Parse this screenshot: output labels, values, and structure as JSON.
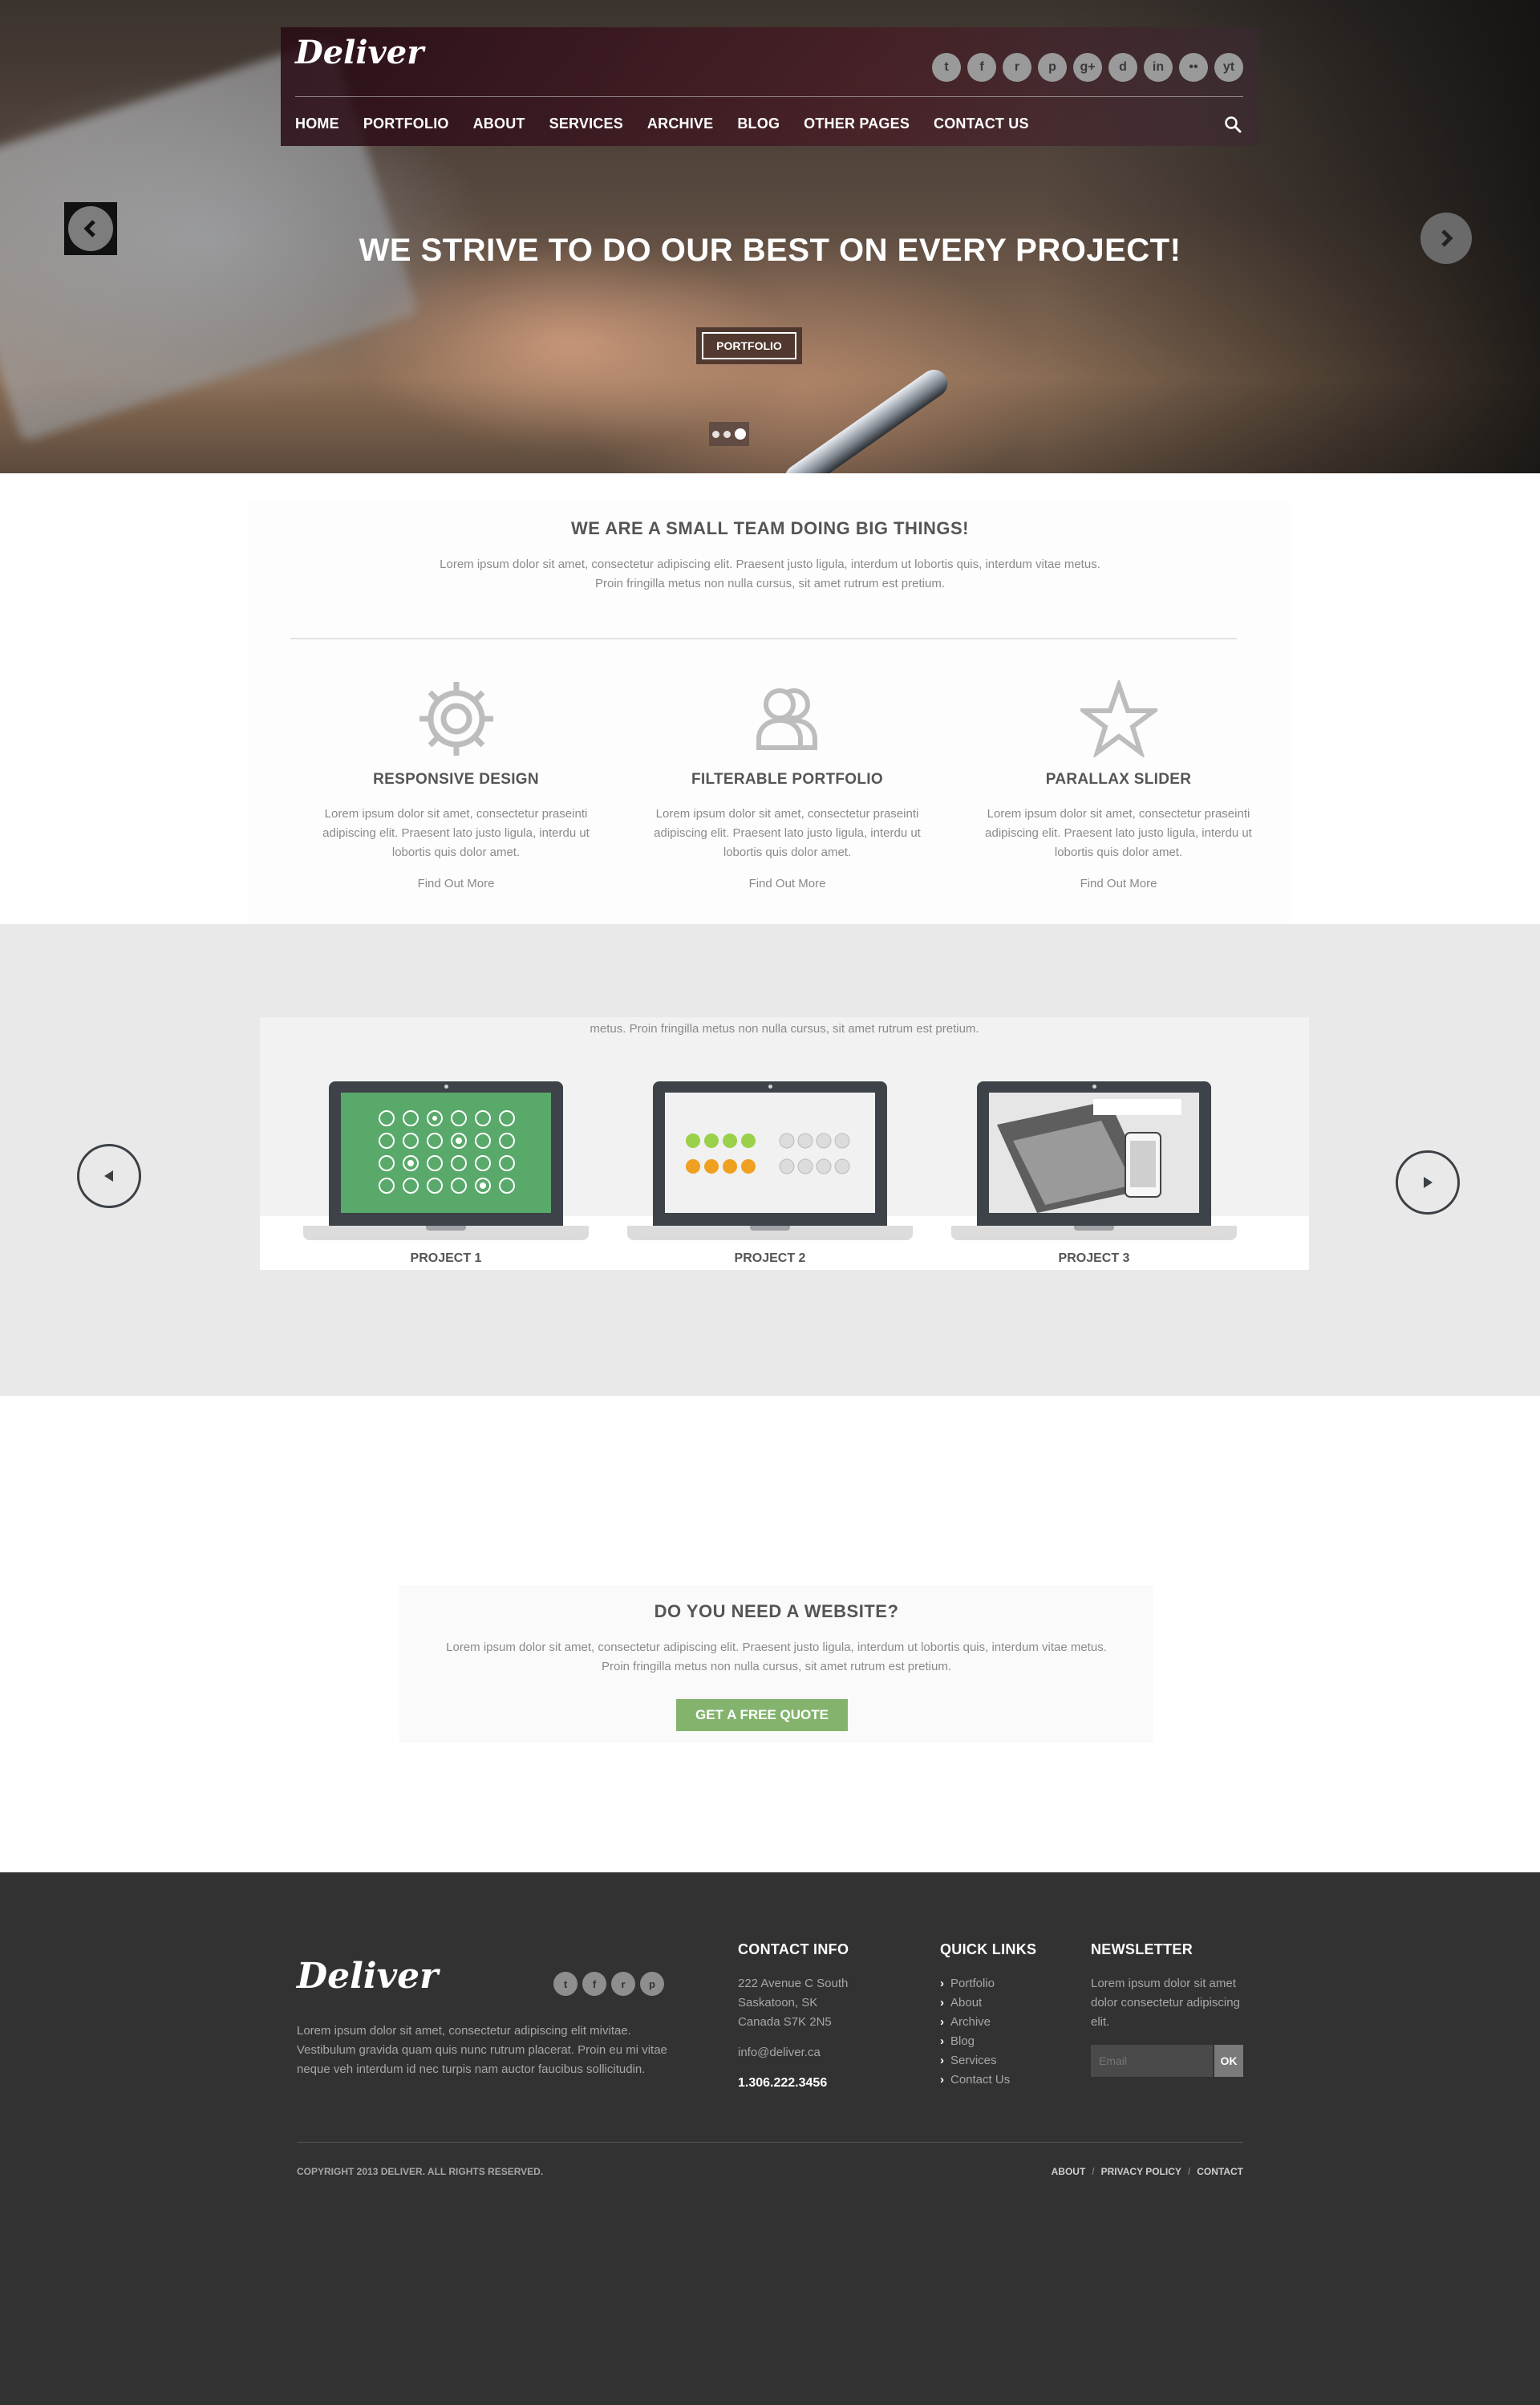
{
  "brand": "Deliver",
  "header": {
    "social": [
      {
        "icon": "twitter-icon",
        "glyph": "t"
      },
      {
        "icon": "facebook-icon",
        "glyph": "f"
      },
      {
        "icon": "rss-icon",
        "glyph": "r"
      },
      {
        "icon": "pinterest-icon",
        "glyph": "p"
      },
      {
        "icon": "google-plus-icon",
        "glyph": "g+"
      },
      {
        "icon": "dribbble-icon",
        "glyph": "d"
      },
      {
        "icon": "linkedin-icon",
        "glyph": "in"
      },
      {
        "icon": "flickr-icon",
        "glyph": "••"
      },
      {
        "icon": "youtube-icon",
        "glyph": "yt"
      }
    ],
    "nav": [
      "HOME",
      "PORTFOLIO",
      "ABOUT",
      "SERVICES",
      "ARCHIVE",
      "BLOG",
      "OTHER PAGES",
      "CONTACT US"
    ]
  },
  "hero": {
    "title": "WE STRIVE TO DO OUR BEST ON EVERY PROJECT!",
    "button": "PORTFOLIO"
  },
  "intro": {
    "title": "WE ARE A SMALL TEAM DOING BIG THINGS!",
    "text": "Lorem ipsum dolor sit amet, consectetur adipiscing elit. Praesent justo ligula, interdum ut lobortis quis, interdum vitae metus. Proin fringilla metus non nulla cursus, sit amet rutrum est pretium."
  },
  "features": [
    {
      "icon": "gear-icon",
      "title": "RESPONSIVE DESIGN",
      "text": "Lorem ipsum dolor sit amet, consectetur praseinti adipiscing elit. Praesent lato justo ligula, interdu ut lobortis quis dolor amet.",
      "more": "Find Out More"
    },
    {
      "icon": "users-icon",
      "title": "FILTERABLE PORTFOLIO",
      "text": "Lorem ipsum dolor sit amet, consectetur praseinti adipiscing elit. Praesent lato justo ligula, interdu ut lobortis quis dolor amet.",
      "more": "Find Out More"
    },
    {
      "icon": "star-icon",
      "title": "PARALLAX SLIDER",
      "text": "Lorem ipsum dolor sit amet, consectetur praseinti adipiscing elit. Praesent lato justo ligula, interdu ut lobortis quis dolor amet.",
      "more": "Find Out More"
    }
  ],
  "portfolio": {
    "text": "metus. Proin fringilla metus non nulla cursus, sit amet rutrum est pretium.",
    "projects": [
      "PROJECT 1",
      "PROJECT 2",
      "PROJECT 3"
    ]
  },
  "cta": {
    "title": "DO YOU NEED A WEBSITE?",
    "text": "Lorem ipsum dolor sit amet, consectetur adipiscing elit. Praesent justo ligula, interdum ut lobortis quis, interdum vitae metus. Proin fringilla metus non nulla cursus, sit amet rutrum est pretium.",
    "button": "GET A FREE QUOTE"
  },
  "footer": {
    "about": "Lorem ipsum dolor sit amet, consectetur adipiscing elit mivitae. Vestibulum gravida quam quis nunc rutrum placerat. Proin eu mi vitae neque veh interdum id nec turpis nam auctor faucibus sollicitudin.",
    "contact": {
      "title": "CONTACT INFO",
      "address1": "222 Avenue C South",
      "address2": "Saskatoon, SK",
      "address3": "Canada S7K 2N5",
      "email": "info@deliver.ca",
      "phone": "1.306.222.3456"
    },
    "quick_links": {
      "title": "QUICK LINKS",
      "items": [
        "Portfolio",
        "About",
        "Archive",
        "Blog",
        "Services",
        "Contact Us"
      ]
    },
    "newsletter": {
      "title": "NEWSLETTER",
      "text": "Lorem ipsum dolor sit amet dolor consectetur adipiscing elit.",
      "placeholder": "Email",
      "button": "OK"
    },
    "copyright": "COPYRIGHT 2013 DELIVER. ALL RIGHTS RESERVED.",
    "links": [
      "ABOUT",
      "PRIVACY POLICY",
      "CONTACT"
    ]
  }
}
